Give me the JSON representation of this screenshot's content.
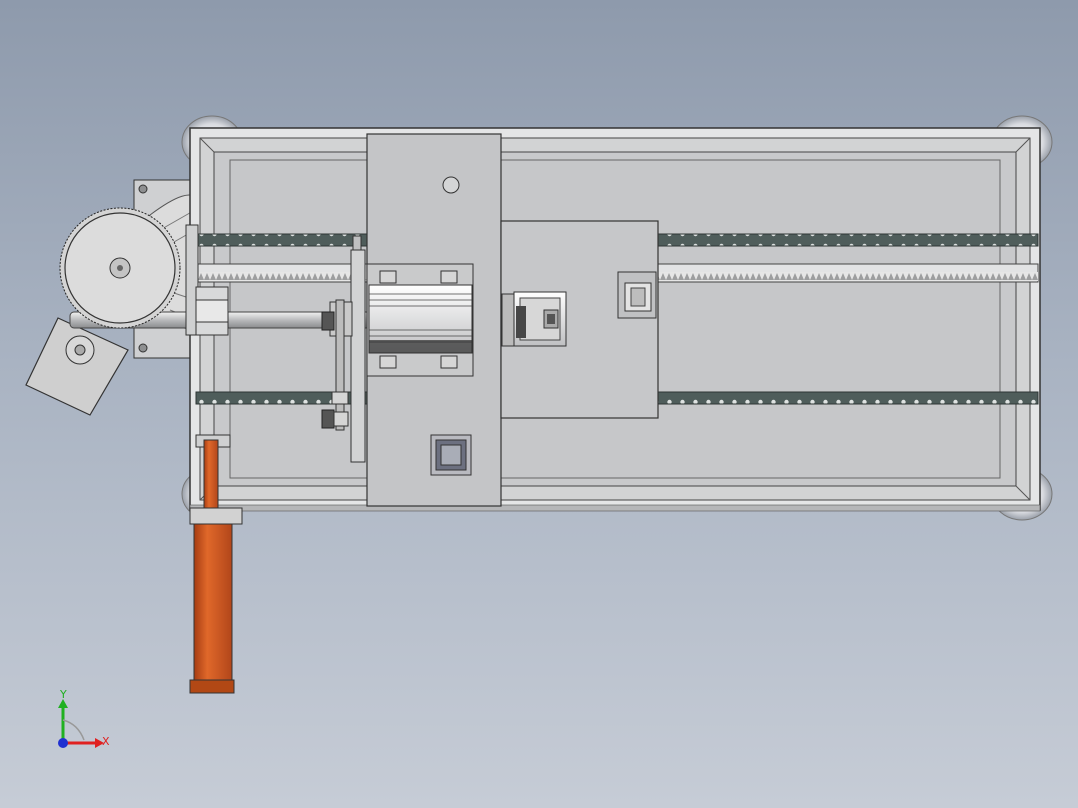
{
  "viewport": {
    "background_top": "#8e9aac",
    "background_bottom": "#c6ccd6"
  },
  "triad": {
    "x_label": "X",
    "y_label": "Y",
    "x_color": "#e02020",
    "y_color": "#20b020",
    "z_color": "#2030d0"
  },
  "colors": {
    "frame": "#cfd0d2",
    "frame_edge": "#3a3a3a",
    "rail": "#4c5a58",
    "carriage": "#c4c5c7",
    "cylinder": "#c8501a",
    "cylinder_cap": "#a63c12"
  }
}
